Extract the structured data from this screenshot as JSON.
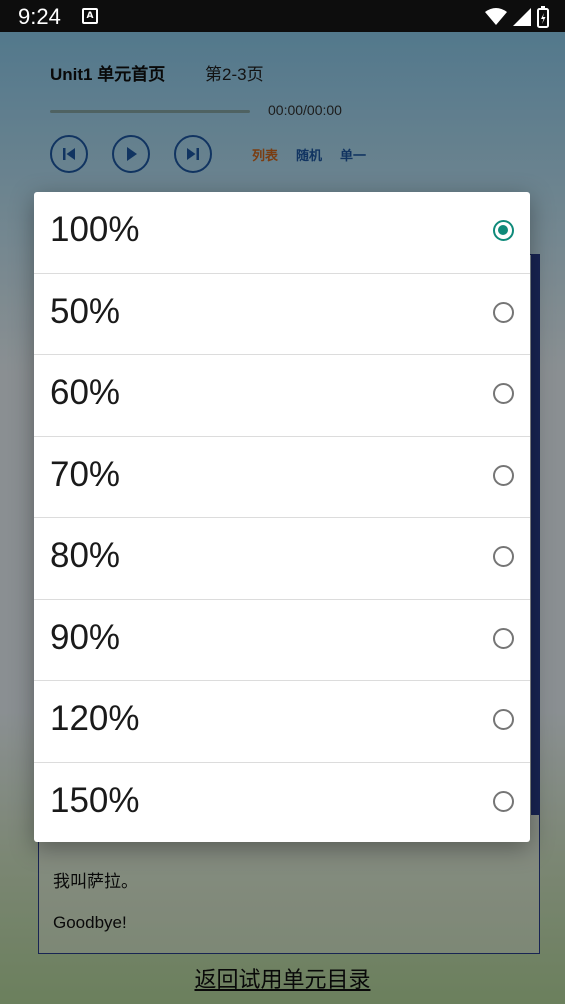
{
  "status_bar": {
    "time": "9:24",
    "notification_icon": "A"
  },
  "app": {
    "title": "Unit1 单元首页",
    "page": "第2-3页",
    "time_display": "00:00/00:00",
    "modes": {
      "list": "列表",
      "random": "随机",
      "single": "单一"
    },
    "mode_colors": {
      "list": "#d2691e",
      "random": "#1e5aa8",
      "single": "#1e5aa8"
    },
    "lyrics": [
      "我叫萨拉。",
      "Goodbye!"
    ],
    "back_link": "返回试用单元目录"
  },
  "dialog": {
    "accent_color": "#0f8a7a",
    "options": [
      {
        "label": "100%",
        "selected": true
      },
      {
        "label": "50%",
        "selected": false
      },
      {
        "label": "60%",
        "selected": false
      },
      {
        "label": "70%",
        "selected": false
      },
      {
        "label": "80%",
        "selected": false
      },
      {
        "label": "90%",
        "selected": false
      },
      {
        "label": "120%",
        "selected": false
      },
      {
        "label": "150%",
        "selected": false
      }
    ]
  }
}
